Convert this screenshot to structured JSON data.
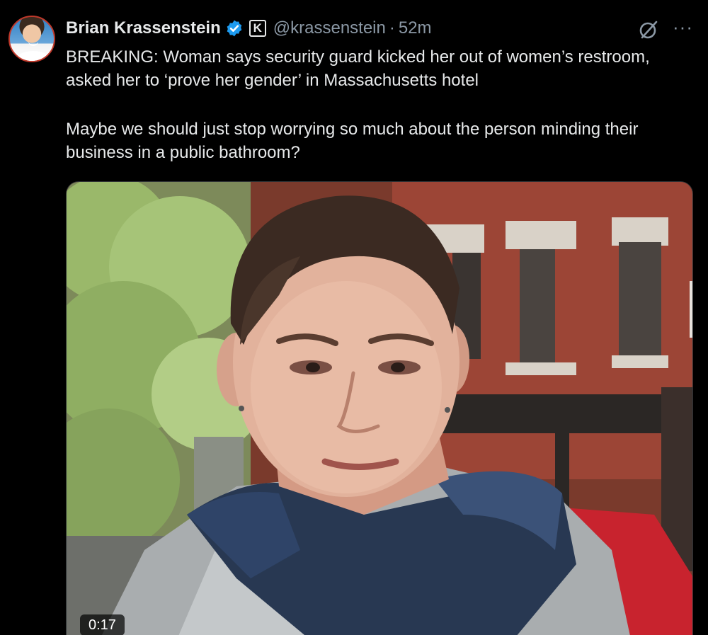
{
  "tweet": {
    "author_name": "Brian Krassenstein",
    "handle": "@krassenstein",
    "separator": "·",
    "time": "52m",
    "affiliation_letter": "K",
    "more": "···",
    "paragraphs": [
      "BREAKING: Woman says security guard kicked her out of women’s restroom, asked her to ‘prove her gender’ in Massachusetts hotel",
      "Maybe we should just stop worrying so much about the person minding their business in a public bathroom?"
    ]
  },
  "media": {
    "type": "video",
    "duration": "0:17"
  },
  "icons": {
    "verified": "verified-badge-icon",
    "affiliation": "affiliation-k-icon",
    "grok": "grok-icon",
    "more": "more-options-icon"
  },
  "colors": {
    "background": "#000000",
    "text": "#e7e9ea",
    "secondary_text": "#8b98a5",
    "verified_blue": "#1d9bf0"
  }
}
